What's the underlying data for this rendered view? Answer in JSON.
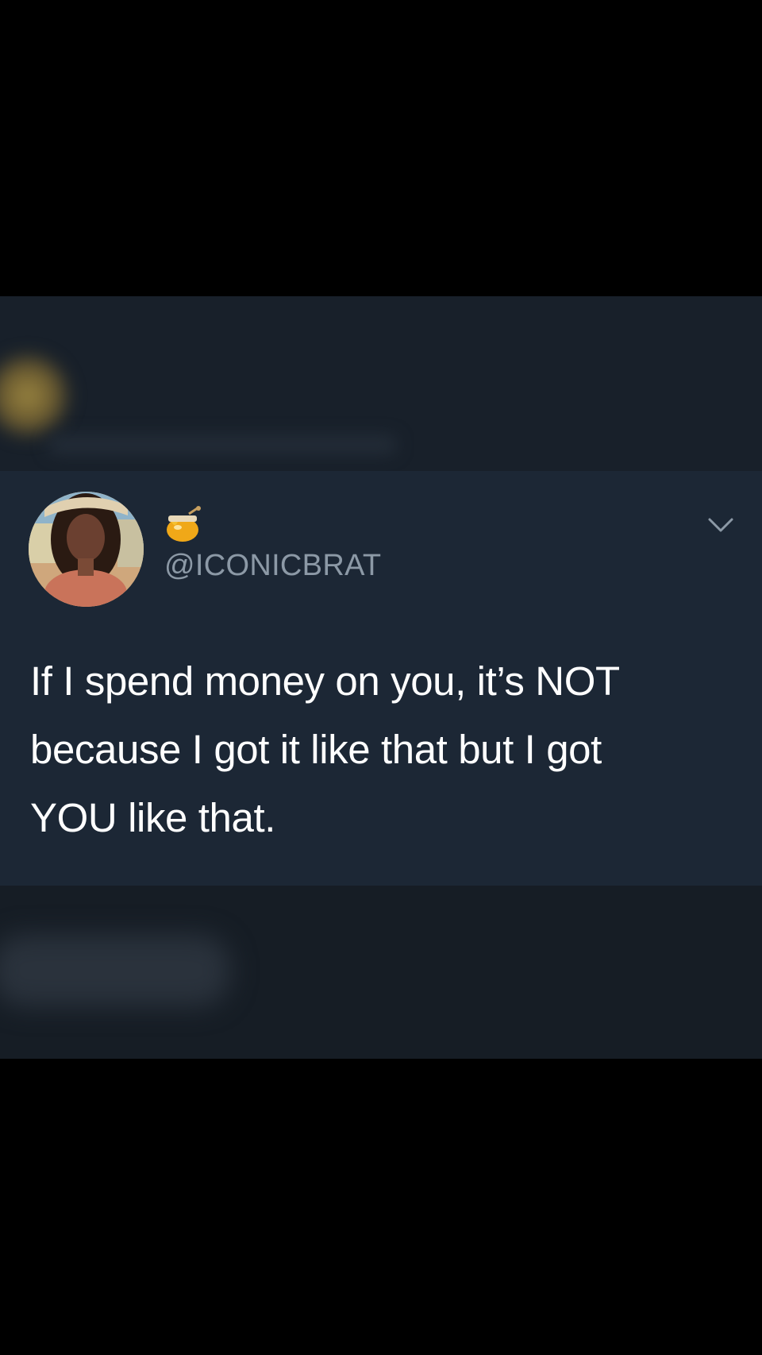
{
  "tweet": {
    "handle": "@ICONICBRAT",
    "badge_icon": "honey-pot-icon",
    "menu_icon": "chevron-down-icon",
    "text": "If I spend money on you, it’s NOT\nbecause I got it like that but I got\nYOU like that."
  },
  "colors": {
    "background": "#000000",
    "tweet_background": "#1c2735",
    "handle_text": "#8c99a6",
    "tweet_text": "#ffffff"
  }
}
